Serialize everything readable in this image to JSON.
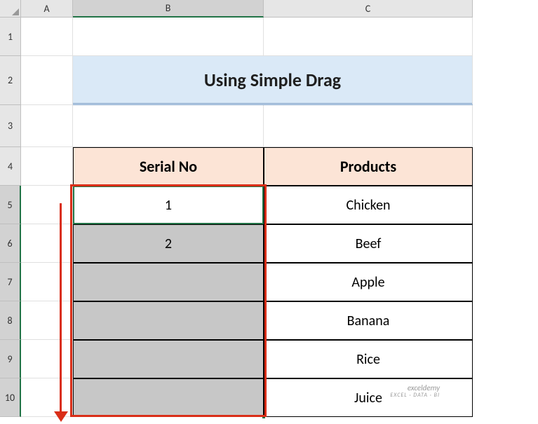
{
  "columns": {
    "A": "A",
    "B": "B",
    "C": "C"
  },
  "rows": [
    "1",
    "2",
    "3",
    "4",
    "5",
    "6",
    "7",
    "8",
    "9",
    "10"
  ],
  "title": "Using Simple Drag",
  "headers": {
    "serial": "Serial No",
    "products": "Products"
  },
  "data": {
    "serial": [
      "1",
      "2",
      "",
      "",
      "",
      ""
    ],
    "products": [
      "Chicken",
      "Beef",
      "Apple",
      "Banana",
      "Rice",
      "Juice"
    ]
  },
  "watermark": {
    "main": "exceldemy",
    "sub": "EXCEL · DATA · BI"
  },
  "chart_data": {
    "type": "table",
    "title": "Using Simple Drag",
    "columns": [
      "Serial No",
      "Products"
    ],
    "rows": [
      [
        "1",
        "Chicken"
      ],
      [
        "2",
        "Beef"
      ],
      [
        "",
        "Apple"
      ],
      [
        "",
        "Banana"
      ],
      [
        "",
        "Rice"
      ],
      [
        "",
        "Juice"
      ]
    ]
  }
}
